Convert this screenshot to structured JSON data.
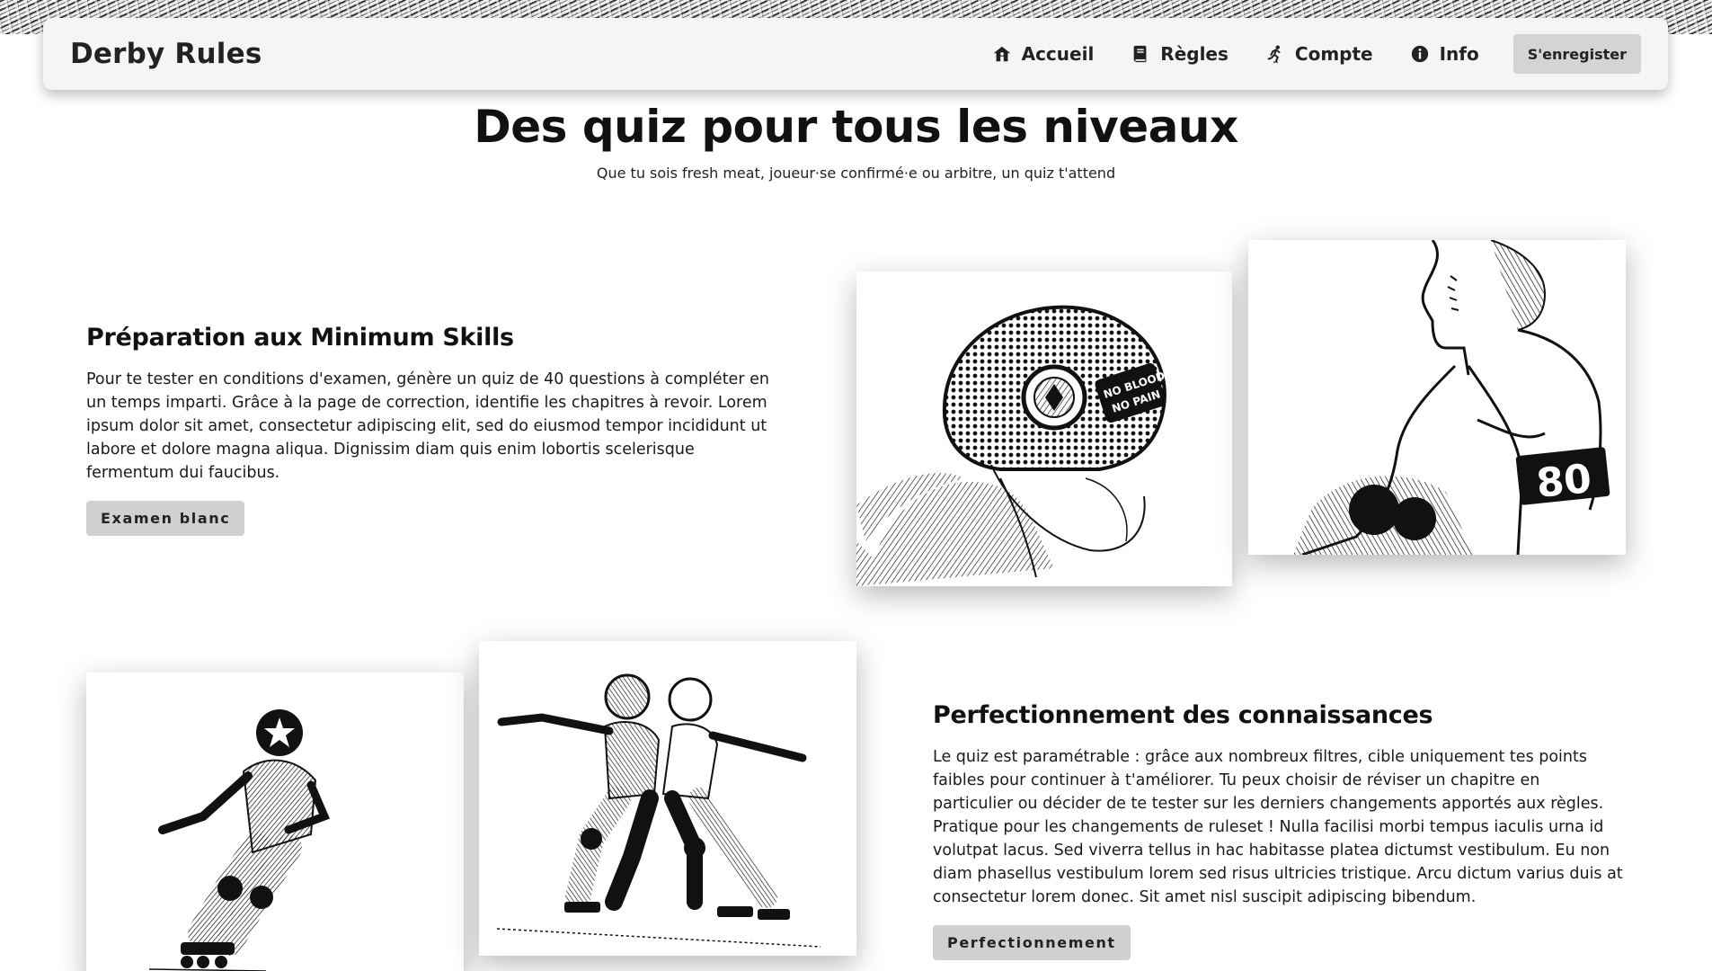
{
  "navbar": {
    "brand": "Derby Rules",
    "links": [
      {
        "label": "Accueil",
        "icon": "home-icon"
      },
      {
        "label": "Règles",
        "icon": "book-icon"
      },
      {
        "label": "Compte",
        "icon": "skater-icon"
      },
      {
        "label": "Info",
        "icon": "info-icon"
      }
    ],
    "register_label": "S'enregister"
  },
  "hero": {
    "title": "Des quiz pour tous les niveaux",
    "subtitle": "Que tu sois fresh meat, joueur·se confirmé·e ou arbitre, un quiz t'attend"
  },
  "sections": [
    {
      "title": "Préparation aux Minimum Skills",
      "text": "Pour te tester en conditions d'examen, génère un quiz de 40 questions à compléter en un temps imparti. Grâce à la page de correction, identifie les chapitres à revoir. Lorem ipsum dolor sit amet, consectetur adipiscing elit, sed do eiusmod tempor incididunt ut labore et dolore magna aliqua. Dignissim diam quis enim lobortis scelerisque fermentum dui faucibus.",
      "button": "Examen blanc"
    },
    {
      "title": "Perfectionnement des connaissances",
      "text": "Le quiz est paramétrable : grâce aux nombreux filtres, cible uniquement tes points faibles pour continuer à t'améliorer. Tu peux choisir de réviser un chapitre en particulier ou décider de te tester sur les derniers changements apportés aux règles. Pratique pour les changements de ruleset ! Nulla facilisi morbi tempus iaculis urna id volutpat lacus. Sed viverra tellus in hac habitasse platea dictumst vestibulum. Eu non diam phasellus vestibulum lorem sed risus ultricies tristique. Arcu dictum varius duis at consectetur lorem donec. Sit amet nisl suscipit adipiscing bibendum.",
      "button": "Perfectionnement"
    }
  ],
  "images": {
    "helmet_text": "NO BLOOD NO PAIN",
    "armband_number": "80"
  },
  "colors": {
    "navbar_bg": "#f5f5f5",
    "button_bg": "#d4d4d4",
    "text": "#111111"
  }
}
